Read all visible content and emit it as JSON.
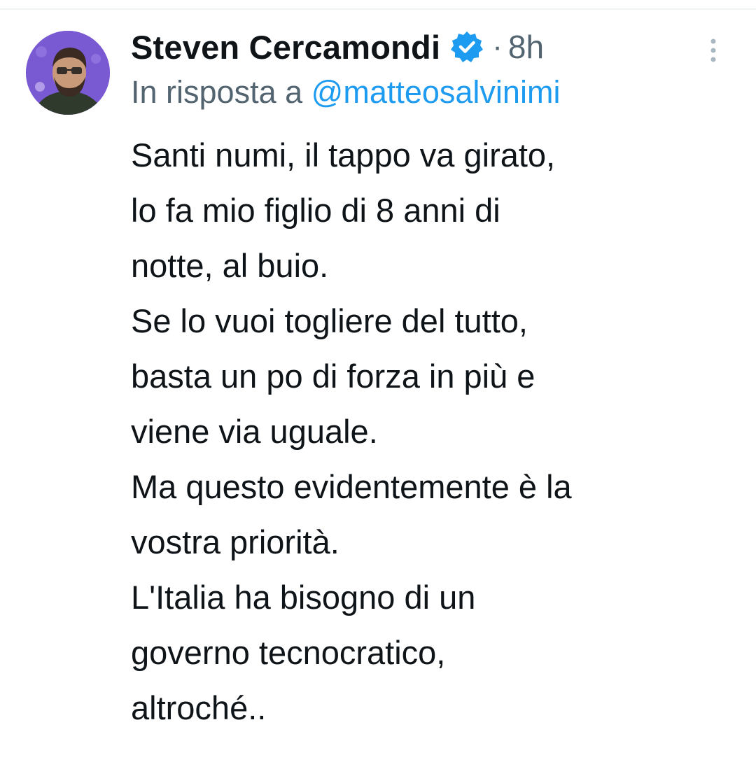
{
  "tweet": {
    "author_name": "Steven Cercamondi",
    "separator": "·",
    "time": "8h",
    "reply_prefix": "In risposta a",
    "reply_handle": "@matteosalvinimi",
    "lines": [
      "Santi numi, il tappo va girato,",
      "lo fa mio figlio di 8 anni di",
      "notte, al buio.",
      "Se lo vuoi togliere del tutto,",
      "basta un po di forza in più e",
      "viene via uguale.",
      "Ma questo evidentemente è la",
      "vostra priorità.",
      "L'Italia ha bisogno di un",
      "governo tecnocratico,",
      "altroché.."
    ]
  },
  "icons": {
    "verified": "verified-badge-icon",
    "more": "more-vertical-icon"
  },
  "colors": {
    "text": "#0f1419",
    "secondary": "#536471",
    "link": "#1d9bf0",
    "verified": "#1d9bf0",
    "avatar_bg": "#7b5bd6"
  }
}
